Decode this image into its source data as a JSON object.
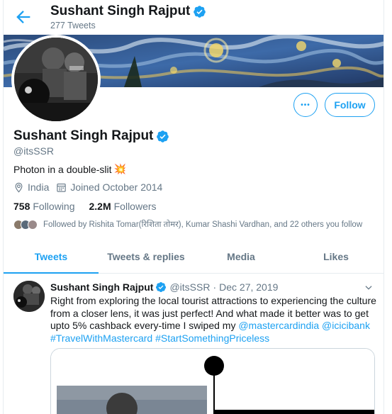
{
  "header": {
    "name": "Sushant Singh Rajput",
    "tweet_count": "277 Tweets"
  },
  "profile": {
    "name": "Sushant Singh Rajput",
    "handle": "@itsSSR",
    "bio": "Photon in a double-slit",
    "bio_emoji": "💥",
    "location": "India",
    "joined": "Joined October 2014",
    "following_count": "758",
    "following_label": "Following",
    "followers_count": "2.2M",
    "followers_label": "Followers",
    "followed_by": "Followed by Rishita Tomar(रिशिता तोमर), Kumar Shashi Vardhan, and 22 others you follow"
  },
  "actions": {
    "more_label": "•••",
    "follow_label": "Follow"
  },
  "tabs": [
    {
      "label": "Tweets",
      "active": true
    },
    {
      "label": "Tweets & replies",
      "active": false
    },
    {
      "label": "Media",
      "active": false
    },
    {
      "label": "Likes",
      "active": false
    }
  ],
  "tweet": {
    "name": "Sushant Singh Rajput",
    "handle": "@itsSSR",
    "separator": "·",
    "date": "Dec 27, 2019",
    "text_part1": "Right from exploring the local tourist attractions to experiencing the culture from a closer lens, it was just perfect! And what made it better was to get upto 5% cashback every-time I swiped my ",
    "mention1": "@mastercardindia",
    "space": " ",
    "mention2": "@icicibank",
    "hashtag1": "#TravelWithMastercard",
    "hashtag2": "#StartSomethingPriceless"
  },
  "colors": {
    "accent": "#1da1f2",
    "secondary_text": "#657786",
    "primary_text": "#14171a",
    "border": "#e6ecf0"
  },
  "icons": {
    "back": "back-arrow-icon",
    "verified": "verified-badge-icon",
    "location": "location-pin-icon",
    "calendar": "calendar-icon",
    "caret": "chevron-down-icon"
  }
}
